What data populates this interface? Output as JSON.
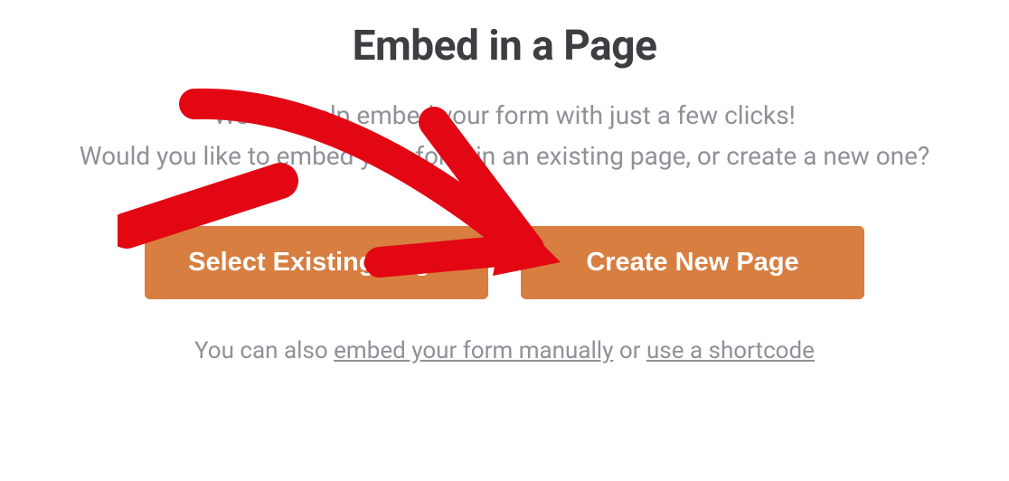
{
  "title": "Embed in a Page",
  "subtitle_line1": "We can help embed your form with just a few clicks!",
  "subtitle_line2": "Would you like to embed your form in an existing page, or create a new one?",
  "buttons": {
    "select_existing": "Select Existing Page",
    "create_new": "Create New Page"
  },
  "footer": {
    "prefix": "You can also ",
    "link1": "embed your form manually",
    "mid": " or ",
    "link2": "use a shortcode"
  },
  "annotation": {
    "type": "arrow",
    "color": "#e30613",
    "target": "create-new-page-button"
  }
}
